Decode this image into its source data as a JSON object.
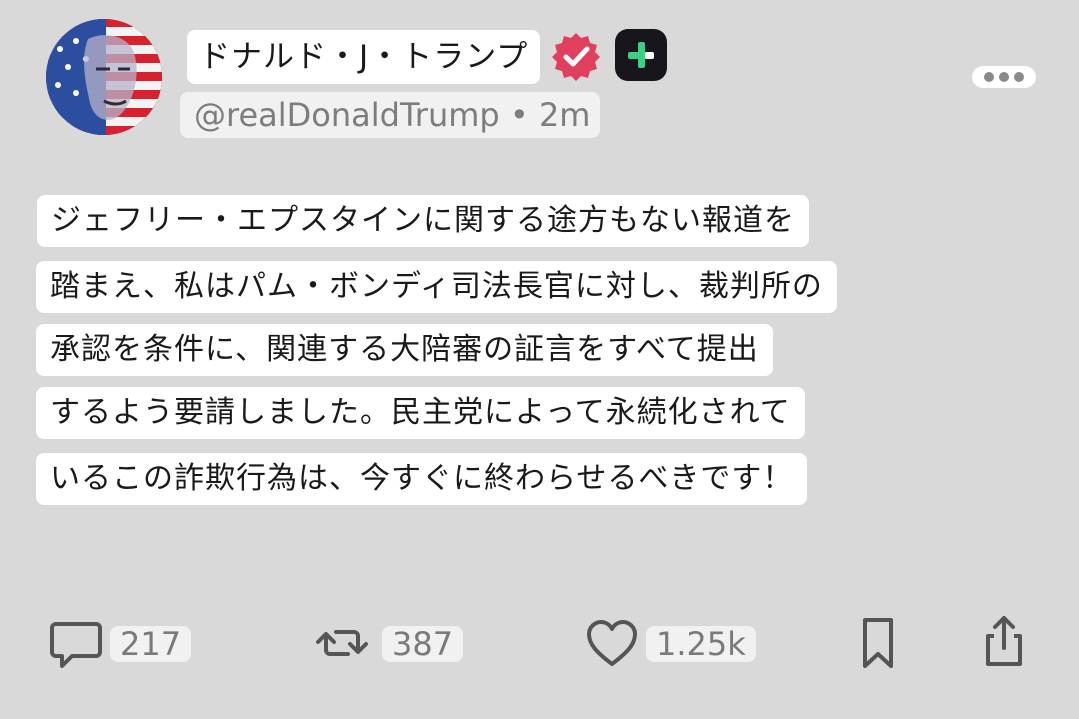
{
  "author": {
    "display_name": "ドナルド・J・トランプ",
    "handle_time": "@realDonaldTrump • 2m",
    "avatar_icon": "flag-portrait-avatar",
    "verified_icon": "verified-badge-icon",
    "verified_color": "#e0405e",
    "app_icon": "app-plus-icon"
  },
  "post": {
    "lines": [
      "ジェフリー・エプスタインに関する途方もない報道を",
      "踏まえ、私はパム・ボンディ司法長官に対し、裁判所の",
      "承認を条件に、関連する大陪審の証言をすべて提出",
      "するよう要請しました。民主党によって永続化されて",
      "いるこの詐欺行為は、今すぐに終わらせるべきです！"
    ]
  },
  "actions": {
    "reply_count": "217",
    "repost_count": "387",
    "like_count": "1.25k",
    "icons": [
      "comment-icon",
      "repost-icon",
      "heart-icon",
      "bookmark-icon",
      "share-icon"
    ]
  },
  "theme": {
    "background": "#d9d9d9",
    "accent": "#3ccf86"
  }
}
